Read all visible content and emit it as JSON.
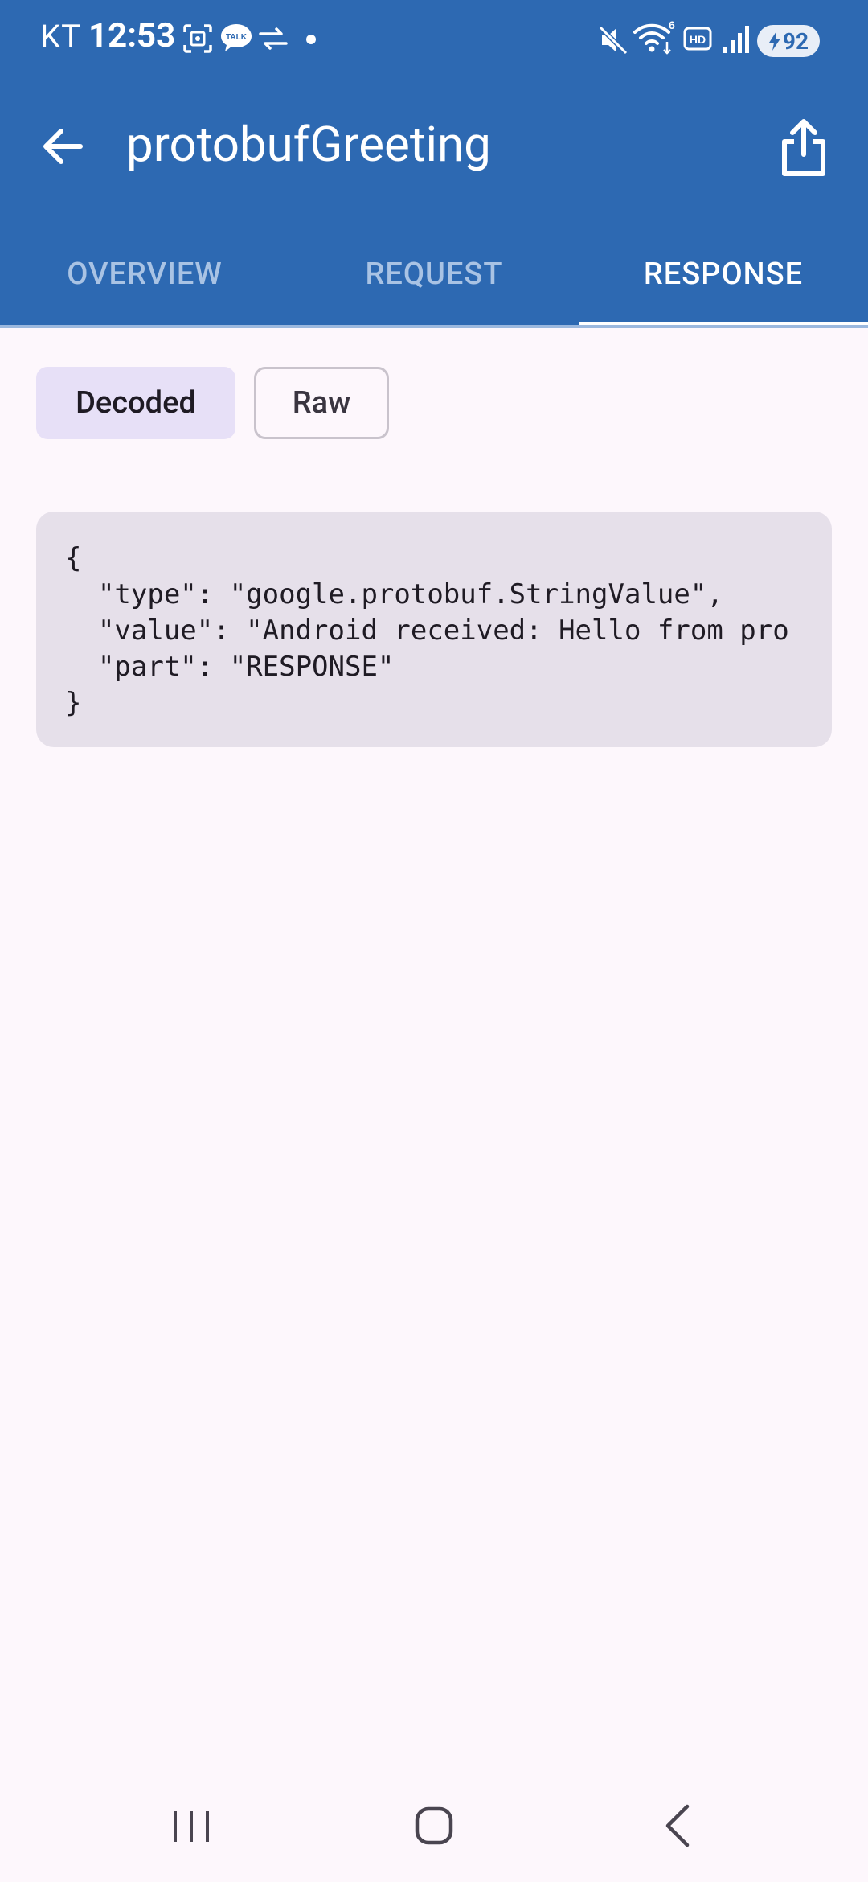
{
  "status_bar": {
    "carrier": "KT",
    "time": "12:53",
    "battery": "92",
    "icons": [
      "screenshot-icon",
      "talk-icon",
      "data-transfer-icon",
      "dot-icon",
      "mute-icon",
      "wifi-icon",
      "hd-icon",
      "signal-icon",
      "battery-icon"
    ]
  },
  "toolbar": {
    "title": "protobufGreeting",
    "back_icon": "arrow-back-icon",
    "share_icon": "share-icon"
  },
  "tabs": [
    {
      "label": "OVERVIEW",
      "active": false
    },
    {
      "label": "REQUEST",
      "active": false
    },
    {
      "label": "RESPONSE",
      "active": true
    }
  ],
  "format_toggle": {
    "decoded_label": "Decoded",
    "raw_label": "Raw",
    "selected": "Decoded"
  },
  "body": {
    "lines": [
      "{",
      "  \"type\": \"google.protobuf.StringValue\",",
      "  \"value\": \"Android received: Hello from pro",
      "  \"part\": \"RESPONSE\"",
      "}"
    ]
  },
  "nav_bar": {
    "recents_icon": "recents-icon",
    "home_icon": "home-icon",
    "back_icon": "nav-back-icon"
  },
  "colors": {
    "primary": "#2D69B2",
    "background": "#FDF7FC",
    "code_background": "#E6E0EA",
    "chip_selected": "#E7E0F7"
  }
}
